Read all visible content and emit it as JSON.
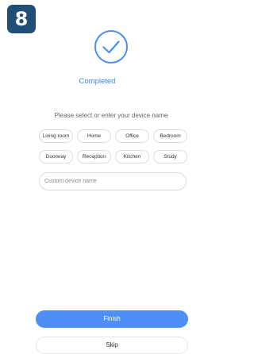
{
  "step_badge": "8",
  "status": {
    "icon": "check-circle-icon",
    "label": "Completed"
  },
  "prompt": "Please select or enter your device name",
  "room_chips": [
    "Living room",
    "Home",
    "Office",
    "Bedroom",
    "Doorway",
    "Reception",
    "Kitchen",
    "Study"
  ],
  "custom_name": {
    "value": "",
    "placeholder": "Custom device name"
  },
  "buttons": {
    "finish": "Finish",
    "skip": "Skip"
  },
  "colors": {
    "accent": "#4e8ff5",
    "badge": "#1f4e79",
    "status_text": "#3f86e6"
  }
}
